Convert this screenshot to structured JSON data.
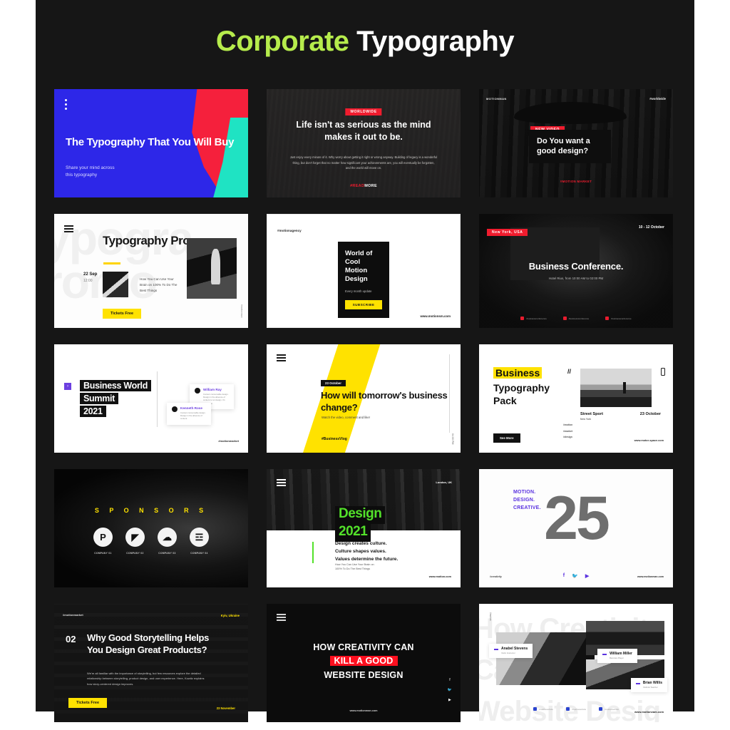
{
  "page": {
    "title_highlight": "Corporate",
    "title_rest": " Typography",
    "background": "#161616",
    "accent_green": "#b6ec4c"
  },
  "cards": [
    {
      "id": "typography-that-you-will-buy",
      "menu_icon": "kebab-menu-icon",
      "headline": "The Typography That You Will Buy",
      "subtext": "Share your mind across\nthis typography",
      "colors": {
        "bg": "#2d27e8",
        "shape_red": "#f5203c",
        "shape_teal": "#1fe3c3"
      }
    },
    {
      "id": "life-isnt-as-serious",
      "badge": "WORLDWIDE",
      "headline": "Life isn't as serious as the mind makes it out to be.",
      "body": "Just enjoy every minute of it. Why worry about getting it right or wrong anyway. Building of legacy is a wonderful thing, but don't forget that no matter how significant your achievements are, you will eventually be forgotten, and the world will move on.",
      "link_hash": "#READ",
      "link_word": "MORE",
      "colors": {
        "badge": "#f01c2e"
      }
    },
    {
      "id": "do-you-want-a-good-design",
      "brand": "MOTIONMAN",
      "tag_right": "#worldwide",
      "badge": "NEW VIDEO",
      "headline": "Do You want a good design?",
      "footer": "#MOTION MARKET"
    },
    {
      "id": "typography-promo",
      "ghost_text": "ypogra\nromo",
      "menu_icon": "hamburger-icon",
      "headline": "Typography Promo",
      "date": "22 Sep",
      "time": "12:00",
      "body": "How You Can Use Your Brain on 100% To Do The Best Things",
      "button": "Tickets Free",
      "vertical_tag": "#motionman"
    },
    {
      "id": "world-of-cool-motion-design",
      "tag": "#motionagency",
      "headline": "World of Cool Motion Design",
      "subtext": "Every month update",
      "button": "SUBSCRIBE",
      "url": "www.motionsm.com"
    },
    {
      "id": "business-conference",
      "badge": "New York, USA",
      "dates": "10 - 12 October",
      "headline": "Business Conference.",
      "subtext": "Hotel Rius, from 10:00 AM to 02:00 PM",
      "socials": [
        {
          "icon": "facebook-icon",
          "label": "/businessconference"
        },
        {
          "icon": "twitter-icon",
          "label": "/businessconference"
        },
        {
          "icon": "youtube-icon",
          "label": "/businessconference"
        }
      ]
    },
    {
      "id": "business-world-summit",
      "arrow_icon": "chevron-right-icon",
      "headline_lines": [
        "Business World",
        "Summit",
        "2021"
      ],
      "testimonials": [
        {
          "name": "William Ray",
          "text": "Content consumable design. Design in the absence of content is not design. It's decoration."
        },
        {
          "name": "Kenneth Rose",
          "text": "Content consumable design. Design in the absence of content."
        }
      ],
      "tag": "#motionmarket"
    },
    {
      "id": "how-will-tomorrows-business-change",
      "menu_icon": "hamburger-icon",
      "badge": "23 October",
      "headline": "How will tomorrow's business change?",
      "subtext": "Watch the video, comment and like!",
      "tag": "#BusinessVlog",
      "vertical_time": "04:00 PM"
    },
    {
      "id": "business-typography-pack",
      "headline_highlight": "Business",
      "headline_rest": "Typography\nPack",
      "slash": "//",
      "media_title": "Street Sport",
      "media_city": "New York",
      "media_date": "23 October",
      "tags": [
        "#motion",
        "#market",
        "#design"
      ],
      "button": "See More",
      "url": "www.motor-space.com"
    },
    {
      "id": "sponsors",
      "title": "S P O N S O R S",
      "items": [
        {
          "icon": "pinterest-icon",
          "glyph": "P",
          "label": "COMPANY 01"
        },
        {
          "icon": "behance-icon",
          "glyph": "◤",
          "label": "COMPANY 02"
        },
        {
          "icon": "soundcloud-icon",
          "glyph": "☁",
          "label": "COMPANY 03"
        },
        {
          "icon": "audio-wave-icon",
          "glyph": "☲",
          "label": "COMPANY 04"
        }
      ]
    },
    {
      "id": "design-2021",
      "menu_icon": "hamburger-icon",
      "location": "London, UK",
      "title_line1": "Design",
      "title_line2": "2021",
      "lines": "Design creates culture.\nCulture shapes values.\nValues determine the future.",
      "small": "How You Can Use Your Brain on\n100% To Do The Best Things",
      "url": "www.motion.com"
    },
    {
      "id": "motion-design-creative-25",
      "kicker": "MOTION.\nDESIGN.\nCREATIVE.",
      "number": "25",
      "tag": "#creativity",
      "socials": [
        "facebook-icon",
        "twitter-icon",
        "youtube-icon"
      ],
      "url": "www.motionman.com"
    },
    {
      "id": "why-good-storytelling",
      "tag": "#motionmarket",
      "location": "Kyiv, Ukraine",
      "number": "02",
      "headline": "Why Good Storytelling Helps You Design Great Products?",
      "body": "We're all familiar with the importance of storytelling, but few resources explore the detailed relationship between storytelling, product design, and user experience. Here, Kowitz explains how story-centered design improves.",
      "button": "Tickets Free",
      "date": "23 November"
    },
    {
      "id": "how-creativity-can-kill",
      "menu_icon": "hamburger-icon",
      "line1": "HOW CREATIVITY CAN",
      "line2": "KILL A GOOD",
      "line3": "WEBSITE DESIGN",
      "url": "www.motionman.com",
      "socials": [
        "facebook-icon",
        "twitter-icon",
        "youtube-icon"
      ]
    },
    {
      "id": "creativity-website-design-people",
      "ghost_text": "How Creativity\nCan\nWebsite Desig",
      "vertical_tag": "#motion",
      "people": [
        {
          "name": "Anabel Stevens",
          "role": "Violin Instructor"
        },
        {
          "name": "William Miller",
          "role": "Bandura Player"
        },
        {
          "name": "Brian Willis",
          "role": "Violinist Teacher"
        }
      ],
      "socials": [
        {
          "icon": "facebook-icon",
          "label": "/creativewebsite"
        },
        {
          "icon": "twitter-icon",
          "label": "/creativewebsite"
        },
        {
          "icon": "youtube-icon",
          "label": "/creativewebsite"
        }
      ],
      "url": "www.motionvam.com"
    }
  ]
}
